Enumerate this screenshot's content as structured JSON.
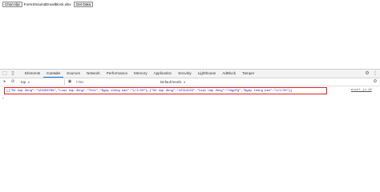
{
  "page": {
    "choose_file_label": "Chọn tệp",
    "file_name": "FormShouindEmailblock.xlsx",
    "get_data_label": "Get Data"
  },
  "devtools": {
    "tabs": [
      {
        "label": "Elements",
        "active": false
      },
      {
        "label": "Console",
        "active": true
      },
      {
        "label": "Sources",
        "active": false
      },
      {
        "label": "Network",
        "active": false
      },
      {
        "label": "Performance",
        "active": false
      },
      {
        "label": "Memory",
        "active": false
      },
      {
        "label": "Application",
        "active": false
      },
      {
        "label": "Security",
        "active": false
      },
      {
        "label": "Lighthouse",
        "active": false
      },
      {
        "label": "AdBlock",
        "active": false
      },
      {
        "label": "Tamper",
        "active": false
      }
    ],
    "toolbar": {
      "context": "top",
      "filter_placeholder": "Filter",
      "levels": "Default levels"
    },
    "console": {
      "log_text": "[{\"Số hợp đồng\":\"123456789\",\"Loại hợp đồng\":\"Test\",\"Ngày thông báo\":\"1/1/20\"},{\"Số hợp đồng\":\"12314124\",\"Loại hợp đồng\":\"fdgdfg\",\"Ngày thông báo\":\"1/1/20\"}]",
      "source": "excel.js:18"
    }
  },
  "colors": {
    "active_tab": "#1a73e8",
    "highlight_border": "#e02020",
    "log_text": "#1c1cad"
  }
}
